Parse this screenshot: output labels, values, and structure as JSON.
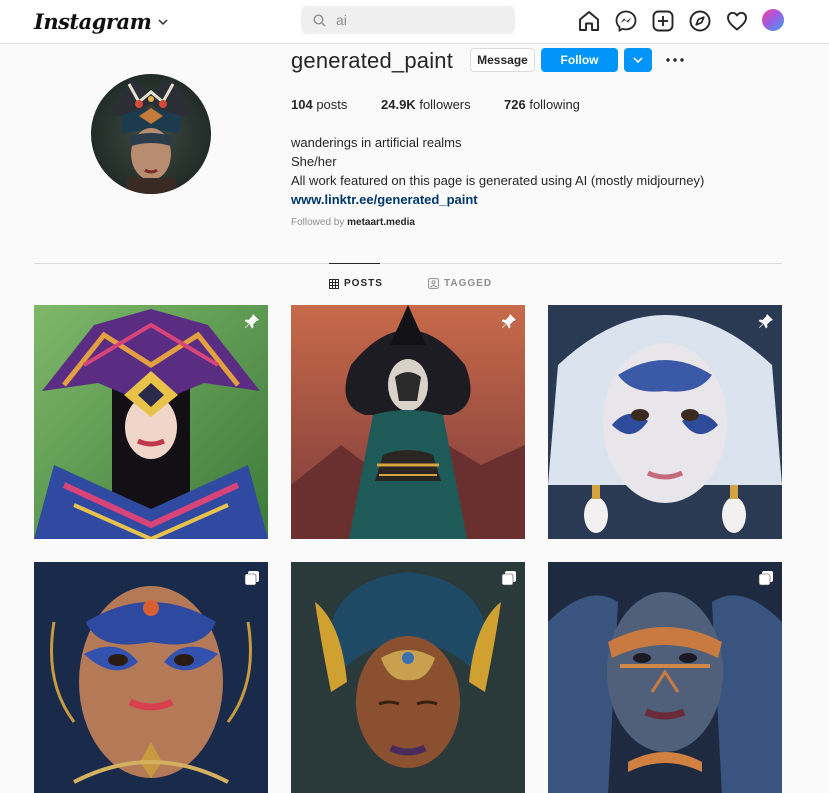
{
  "nav": {
    "logo": "Instagram",
    "search_value": "ai",
    "icons": [
      "home-icon",
      "messenger-icon",
      "new-post-icon",
      "explore-icon",
      "activity-heart-icon",
      "profile-avatar"
    ]
  },
  "profile": {
    "username": "generated_paint",
    "message_label": "Message",
    "follow_label": "Follow",
    "stats": {
      "posts_count": "104",
      "posts_label": "posts",
      "followers_count": "24.9K",
      "followers_label": "followers",
      "following_count": "726",
      "following_label": "following"
    },
    "bio": {
      "line1": "wanderings in artificial realms",
      "line2": "She/her",
      "line3": "All work featured on this page is generated using AI (mostly midjourney)",
      "link": "www.linktr.ee/generated_paint"
    },
    "followed_by_prefix": "Followed by",
    "followed_by_user": "metaart.media"
  },
  "tabs": {
    "posts": "POSTS",
    "tagged": "TAGGED"
  },
  "grid": [
    {
      "subject": "portrait with patterned origami hat",
      "badge": "pin-icon"
    },
    {
      "subject": "figure with black feathered mask",
      "badge": "pin-icon"
    },
    {
      "subject": "face with blue white tribal paint",
      "badge": "pin-icon"
    },
    {
      "subject": "face with blue gold paint",
      "badge": "carousel-icon"
    },
    {
      "subject": "woman with teal turban and gold leaves",
      "badge": "carousel-icon"
    },
    {
      "subject": "face with blue orange paint",
      "badge": "carousel-icon"
    }
  ],
  "colors": {
    "accent": "#0095f6",
    "link": "#00376b",
    "border": "#dbdbdb",
    "text": "#262626",
    "muted": "#8e8e8e"
  }
}
